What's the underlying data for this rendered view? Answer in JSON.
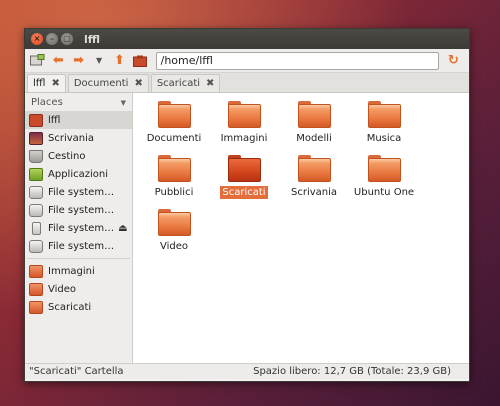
{
  "window": {
    "title": "lffl"
  },
  "toolbar": {
    "location": "/home/lffl"
  },
  "tabs": [
    {
      "label": "lffl"
    },
    {
      "label": "Documenti"
    },
    {
      "label": "Scaricati"
    }
  ],
  "sidebar": {
    "header": "Places",
    "places": [
      {
        "label": "lffl",
        "icon": "home-folder-icon"
      },
      {
        "label": "Scrivania",
        "icon": "desktop-icon"
      },
      {
        "label": "Cestino",
        "icon": "trash-icon"
      },
      {
        "label": "Applicazioni",
        "icon": "applications-icon"
      },
      {
        "label": "File system…",
        "icon": "drive-icon"
      },
      {
        "label": "File system…",
        "icon": "drive-icon"
      },
      {
        "label": "File system…",
        "icon": "usb-drive-icon"
      },
      {
        "label": "File system…",
        "icon": "drive-icon"
      }
    ],
    "bookmarks": [
      {
        "label": "Immagini",
        "icon": "folder-icon"
      },
      {
        "label": "Video",
        "icon": "folder-icon"
      },
      {
        "label": "Scaricati",
        "icon": "folder-icon"
      }
    ]
  },
  "files": [
    {
      "label": "Documenti"
    },
    {
      "label": "Immagini"
    },
    {
      "label": "Modelli"
    },
    {
      "label": "Musica"
    },
    {
      "label": "Pubblici"
    },
    {
      "label": "Scaricati"
    },
    {
      "label": "Scrivania"
    },
    {
      "label": "Ubuntu One"
    },
    {
      "label": "Video"
    }
  ],
  "status": {
    "left": "\"Scaricati\" Cartella",
    "right": "Spazio libero: 12,7 GB (Totale: 23,9 GB)"
  },
  "colors": {
    "accent": "#e36e3c",
    "titlebar": "#3c3b37"
  }
}
